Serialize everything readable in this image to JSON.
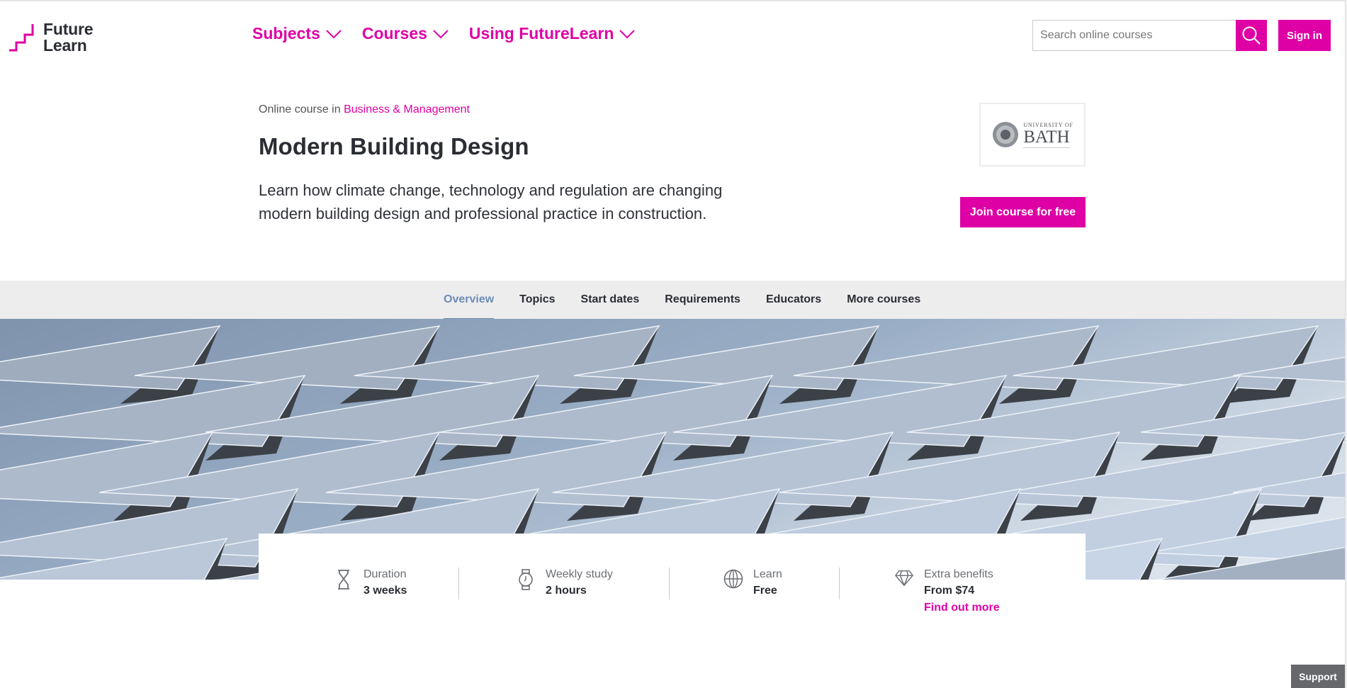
{
  "header": {
    "logo": {
      "line1": "Future",
      "line2": "Learn",
      "icon": "futurelearn-steps-logo"
    },
    "nav": [
      {
        "label": "Subjects",
        "icon": "chevron-down-icon"
      },
      {
        "label": "Courses",
        "icon": "chevron-down-icon"
      },
      {
        "label": "Using FutureLearn",
        "icon": "chevron-down-icon"
      }
    ],
    "search": {
      "placeholder": "Search online courses",
      "value": "",
      "icon": "search-icon"
    },
    "signin_label": "Sign in"
  },
  "course": {
    "crumb_prefix": "Online course in ",
    "category": "Business & Management",
    "title": "Modern Building Design",
    "description": "Learn how climate change, technology and regulation are changing modern building design and professional practice in construction.",
    "provider": {
      "small": "UNIVERSITY OF",
      "big": "BATH"
    },
    "join_label": "Join course for free"
  },
  "tabs": [
    {
      "label": "Overview",
      "active": true
    },
    {
      "label": "Topics",
      "active": false
    },
    {
      "label": "Start dates",
      "active": false
    },
    {
      "label": "Requirements",
      "active": false
    },
    {
      "label": "Educators",
      "active": false
    },
    {
      "label": "More courses",
      "active": false
    }
  ],
  "stats": [
    {
      "icon": "hourglass-icon",
      "label": "Duration",
      "value": "3 weeks"
    },
    {
      "icon": "watch-icon",
      "label": "Weekly study",
      "value": "2 hours"
    },
    {
      "icon": "globe-icon",
      "label": "Learn",
      "value": "Free"
    },
    {
      "icon": "diamond-icon",
      "label": "Extra benefits",
      "value": "From $74",
      "link": "Find out more"
    }
  ],
  "support_label": "Support",
  "colors": {
    "brand": "#de00a5",
    "active_tab": "#6f8cb4",
    "tabbar_bg": "#ededee",
    "text": "#2a2d33"
  }
}
